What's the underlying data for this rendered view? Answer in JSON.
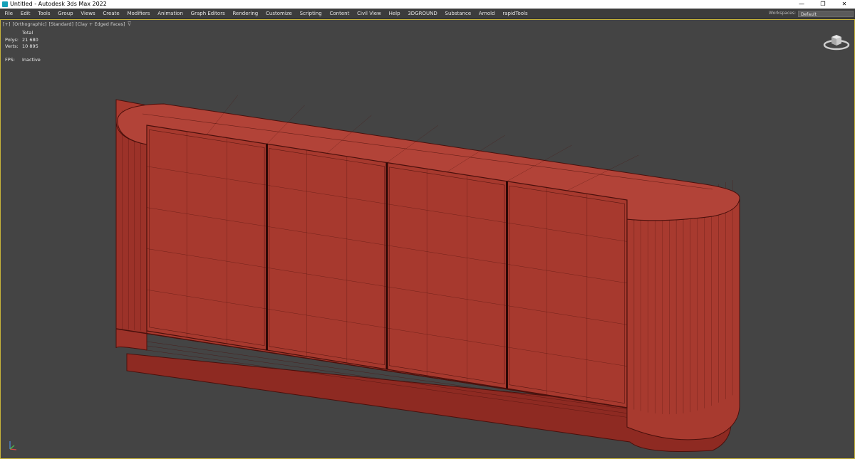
{
  "window": {
    "title": "Untitled - Autodesk 3ds Max 2022",
    "minimize_glyph": "—",
    "restore_glyph": "❐",
    "close_glyph": "✕"
  },
  "menu": {
    "items": [
      "File",
      "Edit",
      "Tools",
      "Group",
      "Views",
      "Create",
      "Modifiers",
      "Animation",
      "Graph Editors",
      "Rendering",
      "Customize",
      "Scripting",
      "Content",
      "Civil View",
      "Help",
      "3DGROUND",
      "Substance",
      "Arnold",
      "rapidTools"
    ]
  },
  "workspace": {
    "label": "Workspaces:",
    "value": "Default"
  },
  "viewport": {
    "labels": [
      "[+]",
      "[Orthographic]",
      "[Standard]",
      "[Clay + Edged Faces]"
    ],
    "filter_icon": "filter-icon",
    "stats": {
      "header": "Total",
      "polys_label": "Polys:",
      "polys_value": "21 680",
      "verts_label": "Verts:",
      "verts_value": "10 895",
      "fps_label": "FPS:",
      "fps_value": "Inactive"
    },
    "highlight_color": "#c8b43a",
    "background_color": "#444444"
  },
  "model": {
    "fill_color": "#a8392e",
    "edge_color": "#4a100c",
    "door_count": 4
  },
  "icons": {
    "viewcube": "viewcube-icon",
    "axis": "axis-tripod-icon"
  }
}
